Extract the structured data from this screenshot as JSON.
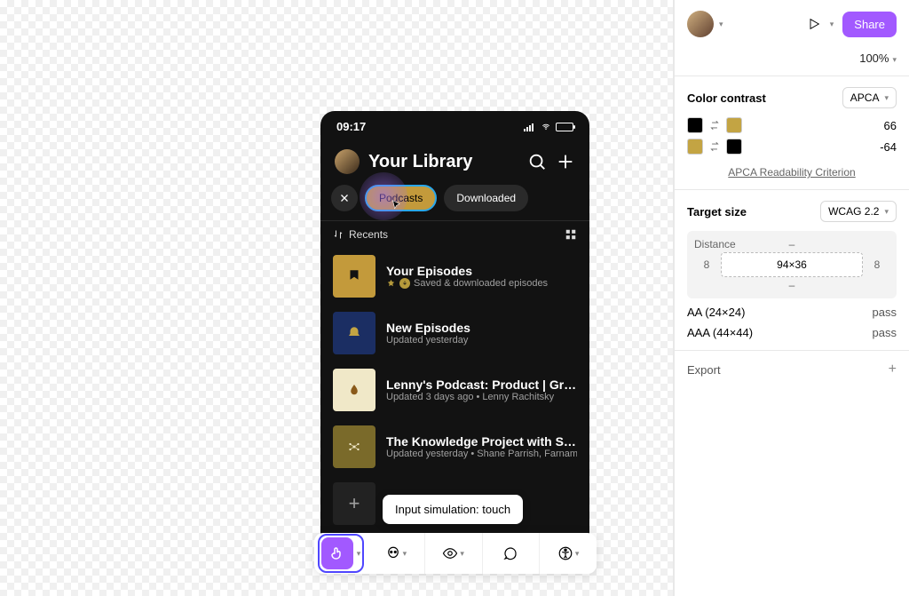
{
  "phone": {
    "time": "09:17",
    "title": "Your Library",
    "chips": {
      "active": "Podcasts",
      "other": "Downloaded"
    },
    "sort_label": "Recents",
    "rows": [
      {
        "title": "Your Episodes",
        "sub": "Saved & downloaded episodes"
      },
      {
        "title": "New Episodes",
        "sub": "Updated yesterday"
      },
      {
        "title": "Lenny's Podcast: Product | Growth | C…",
        "sub": "Updated 3 days ago • Lenny Rachitsky"
      },
      {
        "title": "The Knowledge Project with Shane P…",
        "sub": "Updated yesterday • Shane Parrish, Farnam Str…"
      }
    ],
    "tooltip": "Input simulation: touch"
  },
  "panel": {
    "share": "Share",
    "zoom": "100%",
    "contrast": {
      "title": "Color contrast",
      "mode": "APCA",
      "row1_value": "66",
      "row2_value": "-64",
      "link": "APCA Readability Criterion"
    },
    "target": {
      "title": "Target size",
      "mode": "WCAG 2.2",
      "distance_label": "Distance",
      "dash": "–",
      "left": "8",
      "center": "94×36",
      "right": "8",
      "aa_label": "AA (24×24)",
      "aa_result": "pass",
      "aaa_label": "AAA (44×44)",
      "aaa_result": "pass"
    },
    "export": "Export"
  }
}
